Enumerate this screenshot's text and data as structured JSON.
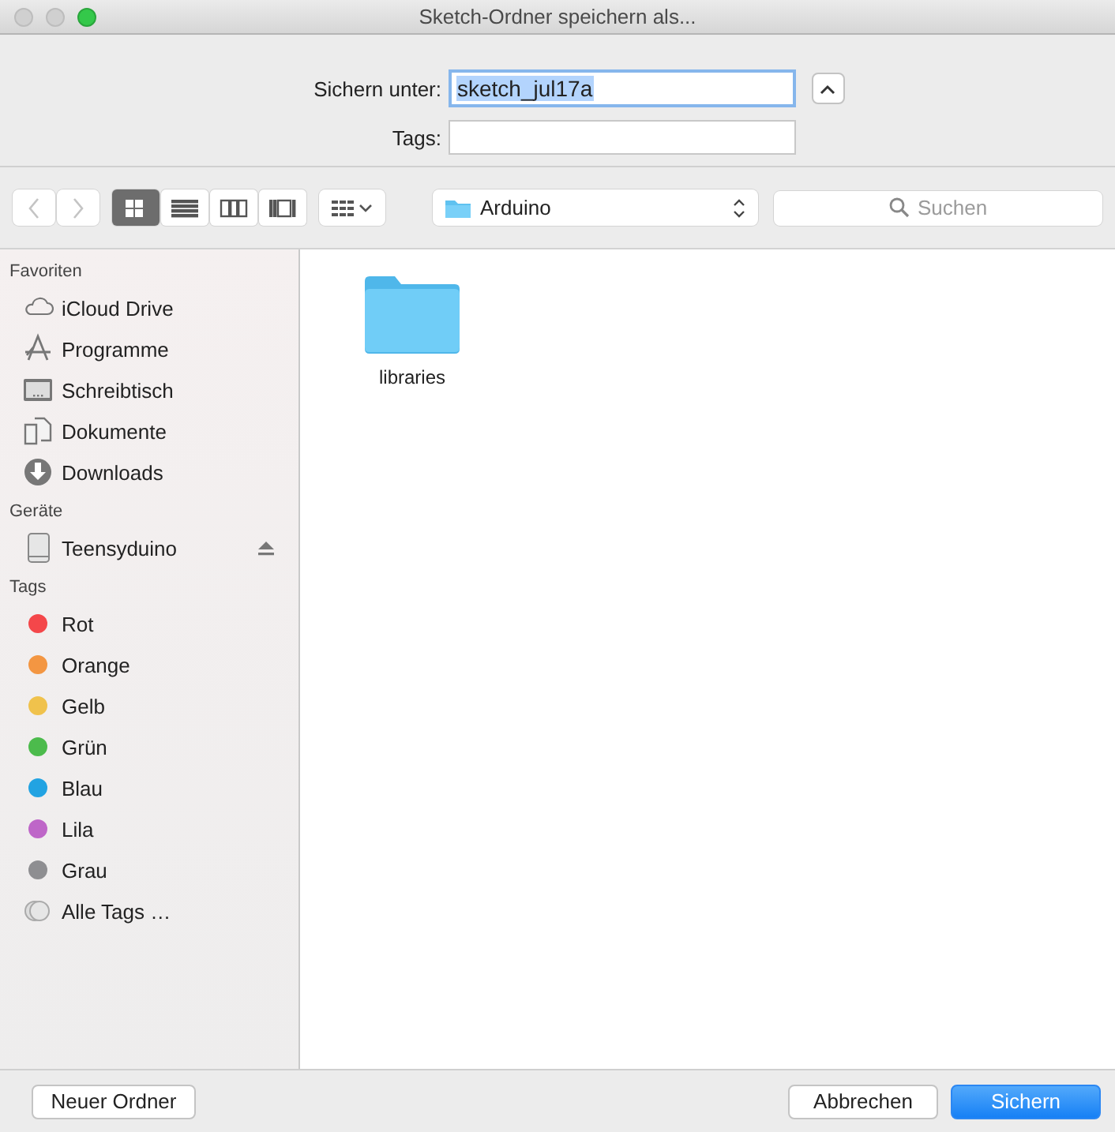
{
  "window": {
    "title": "Sketch-Ordner speichern als...",
    "buttons": [
      {
        "kind": "close",
        "disabled": true
      },
      {
        "kind": "minimize",
        "disabled": true
      },
      {
        "kind": "zoom",
        "disabled": false
      }
    ]
  },
  "save": {
    "name_label": "Sichern unter:",
    "name_value": "sketch_jul17a",
    "tags_label": "Tags:",
    "expanded": true
  },
  "toolbar": {
    "nav": [
      {
        "kind": "back",
        "disabled": true
      },
      {
        "kind": "forward",
        "disabled": true
      }
    ],
    "views": [
      {
        "kind": "icons",
        "selected": true
      },
      {
        "kind": "list",
        "selected": false
      },
      {
        "kind": "columns",
        "selected": false
      },
      {
        "kind": "coverflow",
        "selected": false
      }
    ],
    "location": "Arduino",
    "search": {
      "placeholder": "Suchen"
    }
  },
  "sidebar": {
    "sections": [
      {
        "title": "Favoriten",
        "items": [
          {
            "kind": "cloud",
            "label": "iCloud Drive"
          },
          {
            "kind": "apps",
            "label": "Programme"
          },
          {
            "kind": "desktop",
            "label": "Schreibtisch"
          },
          {
            "kind": "documents",
            "label": "Dokumente"
          },
          {
            "kind": "downloads",
            "label": "Downloads"
          }
        ]
      },
      {
        "title": "Geräte",
        "items": [
          {
            "kind": "drive",
            "label": "Teensyduino"
          }
        ]
      },
      {
        "title": "Tags",
        "items": [
          {
            "kind": "tag",
            "label": "Rot",
            "color": "#f4474a"
          },
          {
            "kind": "tag",
            "label": "Orange",
            "color": "#f39642"
          },
          {
            "kind": "tag",
            "label": "Gelb",
            "color": "#f0c24c"
          },
          {
            "kind": "tag",
            "label": "Grün",
            "color": "#4cbb4c"
          },
          {
            "kind": "tag",
            "label": "Blau",
            "color": "#22a3e2"
          },
          {
            "kind": "tag",
            "label": "Lila",
            "color": "#be66c8"
          },
          {
            "kind": "tag",
            "label": "Grau",
            "color": "#8e8e91"
          },
          {
            "kind": "all_tags",
            "label": "Alle Tags …"
          }
        ]
      }
    ]
  },
  "files": [
    {
      "kind": "folder",
      "name": "libraries"
    }
  ],
  "footer": {
    "new_folder": "Neuer Ordner",
    "cancel": "Abbrechen",
    "save": "Sichern"
  }
}
